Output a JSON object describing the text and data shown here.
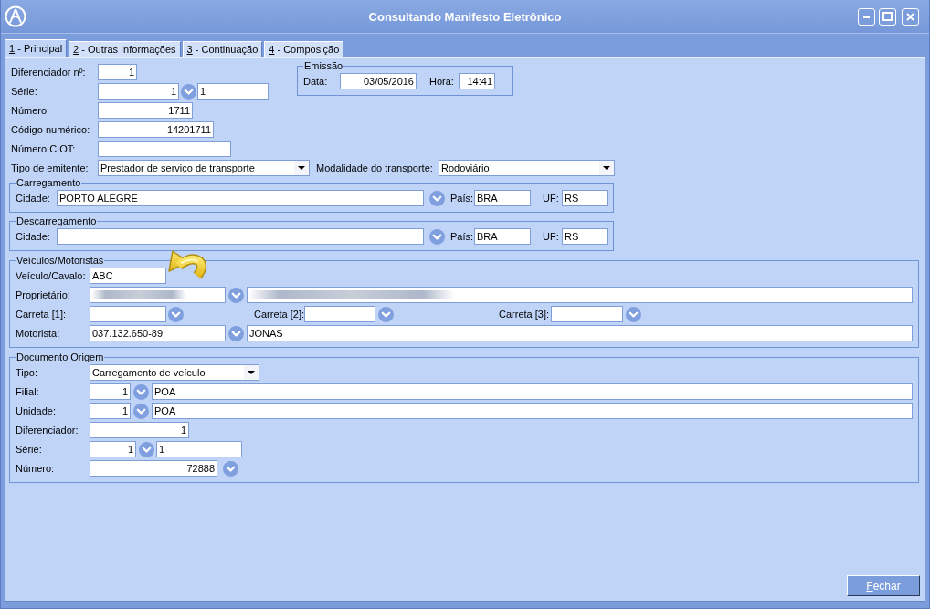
{
  "window": {
    "title": "Consultando Manifesto Eletrônico"
  },
  "tabs": [
    {
      "label": "1 - Principal",
      "selected": true,
      "mnemonic": true
    },
    {
      "label": "2 - Outras Informações",
      "selected": false,
      "mnemonic": true
    },
    {
      "label": "3 - Continuação",
      "selected": false,
      "mnemonic": true
    },
    {
      "label": "4 - Composição",
      "selected": false,
      "mnemonic": true
    }
  ],
  "fields": [
    {
      "label": "Diferenciador nº:",
      "controls": [
        {
          "kind": "number",
          "value": "1"
        }
      ]
    },
    {
      "label": "Série:",
      "controls": [
        {
          "kind": "number",
          "value": "1"
        },
        {
          "kind": "lookup"
        },
        {
          "kind": "text",
          "value": "1"
        }
      ]
    },
    {
      "label": "Número:",
      "controls": [
        {
          "kind": "number",
          "value": "1711"
        }
      ]
    },
    {
      "label": "Código numérico:",
      "controls": [
        {
          "kind": "number",
          "value": "14201711"
        }
      ]
    },
    {
      "label": "Número CIOT:",
      "controls": [
        {
          "kind": "text"
        }
      ]
    },
    {
      "label": "Tipo de emitente:",
      "controls": [
        {
          "kind": "select",
          "value": "Prestador de serviço de transporte"
        },
        {
          "kind": "label",
          "text": "Modalidade do transporte:"
        },
        {
          "kind": "select",
          "value": "Rodoviário"
        }
      ]
    }
  ],
  "emissao": {
    "legend": "Emissão",
    "rows": [
      {
        "label": "Data:",
        "controls": [
          {
            "kind": "number",
            "value": "03/05/2016"
          },
          {
            "kind": "label",
            "text": "Hora:"
          },
          {
            "kind": "number",
            "value": "14:41"
          }
        ]
      }
    ]
  },
  "groups": [
    {
      "legend": "Carregamento",
      "rows": [
        {
          "label": "Cidade:",
          "controls": [
            {
              "kind": "text",
              "value": "PORTO ALEGRE"
            },
            {
              "kind": "lookup"
            },
            {
              "kind": "label",
              "text": "País:"
            },
            {
              "kind": "text",
              "value": "BRA"
            },
            {
              "kind": "label",
              "text": "UF:"
            },
            {
              "kind": "text",
              "value": "RS"
            }
          ]
        }
      ]
    },
    {
      "legend": "Descarregamento",
      "rows": [
        {
          "label": "Cidade:",
          "controls": [
            {
              "kind": "text"
            },
            {
              "kind": "lookup"
            },
            {
              "kind": "label",
              "text": "País:"
            },
            {
              "kind": "text",
              "value": "BRA"
            },
            {
              "kind": "label",
              "text": "UF:"
            },
            {
              "kind": "text",
              "value": "RS"
            }
          ]
        }
      ]
    },
    {
      "legend": "Veículos/Motoristas",
      "rows": [
        {
          "label": "Veículo/Cavalo:",
          "controls": [
            {
              "kind": "text",
              "value": "ABC"
            }
          ]
        },
        {
          "label": "Proprietário:",
          "controls": [
            {
              "kind": "text",
              "redacted": true
            },
            {
              "kind": "lookup"
            },
            {
              "kind": "text",
              "redacted": true
            }
          ]
        },
        {
          "label": "Carreta [1]:",
          "controls": [
            {
              "kind": "text"
            },
            {
              "kind": "lookup"
            },
            {
              "kind": "label",
              "text": "Carreta [2]:"
            },
            {
              "kind": "text"
            },
            {
              "kind": "lookup"
            },
            {
              "kind": "label",
              "text": "Carreta [3]:"
            },
            {
              "kind": "text"
            },
            {
              "kind": "lookup"
            }
          ]
        },
        {
          "label": "Motorista:",
          "controls": [
            {
              "kind": "text",
              "value": "037.132.650-89"
            },
            {
              "kind": "lookup"
            },
            {
              "kind": "text",
              "value": "JONAS"
            }
          ]
        }
      ]
    },
    {
      "legend": "Documento Origem",
      "rows": [
        {
          "label": "Tipo:",
          "controls": [
            {
              "kind": "select",
              "value": "Carregamento de veículo"
            }
          ]
        },
        {
          "label": "Filial:",
          "controls": [
            {
              "kind": "number",
              "value": "1"
            },
            {
              "kind": "lookup"
            },
            {
              "kind": "text",
              "value": "POA"
            }
          ]
        },
        {
          "label": "Unidade:",
          "controls": [
            {
              "kind": "number",
              "value": "1"
            },
            {
              "kind": "lookup"
            },
            {
              "kind": "text",
              "value": "POA"
            }
          ]
        },
        {
          "label": "Diferenciador:",
          "controls": [
            {
              "kind": "number",
              "value": "1"
            }
          ]
        },
        {
          "label": "Série:",
          "controls": [
            {
              "kind": "number",
              "value": "1"
            },
            {
              "kind": "lookup"
            },
            {
              "kind": "text",
              "value": "1"
            }
          ]
        },
        {
          "label": "Número:",
          "controls": [
            {
              "kind": "number",
              "value": "72888"
            },
            {
              "kind": "lookup"
            }
          ]
        }
      ]
    }
  ],
  "buttons": [
    {
      "label": "Fechar",
      "mnemonic": true
    }
  ]
}
